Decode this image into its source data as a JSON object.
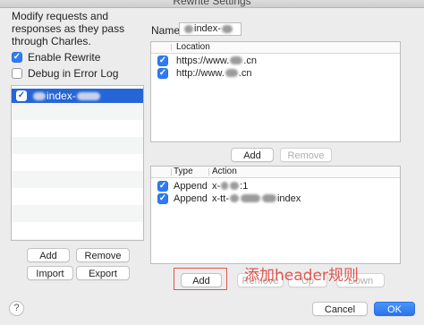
{
  "window": {
    "title": "Rewrite Settings"
  },
  "left": {
    "description": "Modify requests and responses as they pass through Charles.",
    "enable_rewrite": {
      "label": "Enable Rewrite",
      "checked": true
    },
    "debug": {
      "label": "Debug in Error Log",
      "checked": false
    },
    "sets": [
      {
        "label": "index-",
        "checked": true,
        "selected": true
      }
    ],
    "buttons": {
      "add": "Add",
      "remove": "Remove",
      "import": "Import",
      "export": "Export"
    },
    "help": "?"
  },
  "right": {
    "name_label": "Name:",
    "name_value": "index-",
    "locations": {
      "header": {
        "location": "Location"
      },
      "rows": [
        {
          "checked": true,
          "prefix": "https://www.",
          "suffix": ".cn"
        },
        {
          "checked": true,
          "prefix": "http://www.",
          "suffix": ".cn"
        }
      ],
      "buttons": {
        "add": "Add",
        "remove": "Remove"
      }
    },
    "rules": {
      "header": {
        "type": "Type",
        "action": "Action"
      },
      "rows": [
        {
          "checked": true,
          "type": "Append",
          "action_prefix": "x-",
          "action_suffix": ":1"
        },
        {
          "checked": true,
          "type": "Append",
          "action_prefix": "x-tt-",
          "action_suffix": "index"
        }
      ],
      "buttons": {
        "add": "Add",
        "remove": "Remove",
        "up": "Up",
        "down": "Down"
      }
    },
    "annotation": "添加header规则",
    "dialog_buttons": {
      "cancel": "Cancel",
      "ok": "OK"
    }
  },
  "colors": {
    "accent": "#2f7bf6",
    "selection": "#2565d8",
    "annotation": "#e0564e"
  }
}
